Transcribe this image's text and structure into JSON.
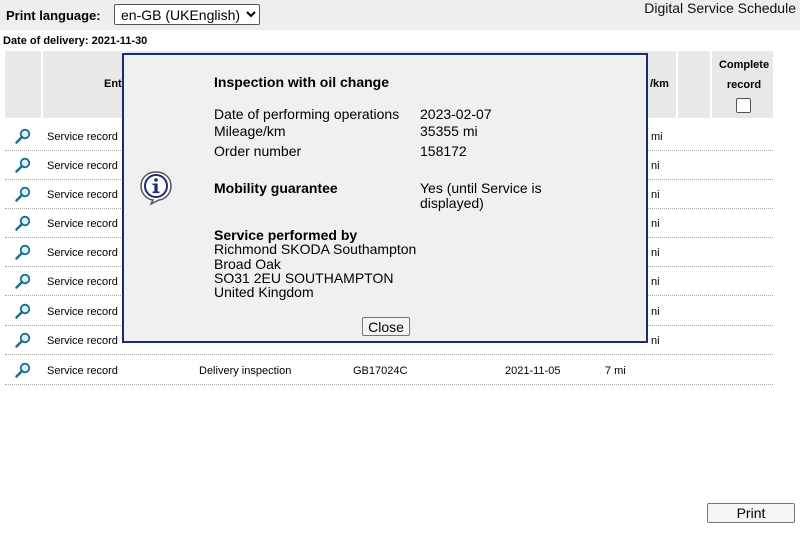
{
  "header": {
    "print_language_label": "Print language:",
    "language_value": "en-GB (UKEnglish)",
    "app_title": "Digital Service Schedule"
  },
  "date_of_delivery": "Date of delivery: 2021-11-30",
  "table": {
    "headers": {
      "entry": "Ent",
      "km": "/km",
      "complete_record": "Complete record"
    },
    "rows": [
      {
        "entry": "Service record",
        "km": "mi"
      },
      {
        "entry": "Service record",
        "km": "ni"
      },
      {
        "entry": "Service record",
        "km": "ni"
      },
      {
        "entry": "Service record",
        "km": "ni"
      },
      {
        "entry": "Service record",
        "km": "ni"
      },
      {
        "entry": "Service record",
        "km": "ni"
      },
      {
        "entry": "Service record",
        "km": "ni"
      },
      {
        "entry": "Service record",
        "km": "ni"
      },
      {
        "entry": "Service record",
        "type": "Delivery inspection",
        "code": "GB17024C",
        "date": "2021-11-05",
        "km": "7 mi"
      }
    ]
  },
  "modal": {
    "title": "Inspection with oil change",
    "date_label": "Date of performing operations",
    "date_value": "2023-02-07",
    "mileage_label": "Mileage/km",
    "mileage_value": "35355 mi",
    "order_label": "Order number",
    "order_value": "158172",
    "mobility_label": "Mobility guarantee",
    "mobility_value_line1": "Yes (until Service is",
    "mobility_value_line2": "displayed)",
    "performed_by_label": "Service performed by",
    "performed_by_lines": [
      "Richmond SKODA Southampton",
      "Broad Oak",
      "SO31 2EU SOUTHAMPTON",
      "United Kingdom"
    ],
    "close_label": "Close",
    "icon": "info-icon"
  },
  "print_label": "Print",
  "colors": {
    "modal_border": "#1c2a74",
    "header_bg": "#e8e8e8",
    "topbar_bg": "#eeeeee"
  }
}
